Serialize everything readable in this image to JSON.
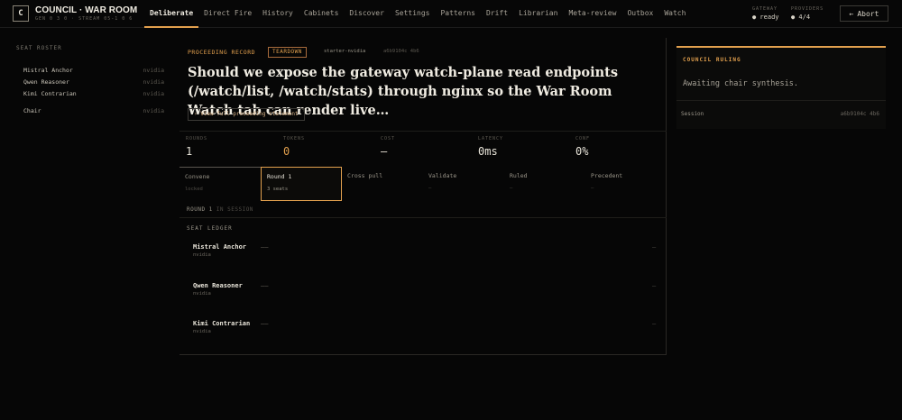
{
  "app": {
    "logo_letter": "C",
    "title": "COUNCIL · WAR ROOM",
    "subtitle": "GEN 0 3 0 · STREAM 05-1 0 6"
  },
  "nav": [
    {
      "label": "Deliberate",
      "active": true
    },
    {
      "label": "Direct Fire",
      "active": false
    },
    {
      "label": "History",
      "active": false
    },
    {
      "label": "Cabinets",
      "active": false
    },
    {
      "label": "Discover",
      "active": false
    },
    {
      "label": "Settings",
      "active": false
    },
    {
      "label": "Patterns",
      "active": false
    },
    {
      "label": "Drift",
      "active": false
    },
    {
      "label": "Librarian",
      "active": false
    },
    {
      "label": "Meta-review",
      "active": false
    },
    {
      "label": "Outbox",
      "active": false
    },
    {
      "label": "Watch",
      "active": false
    }
  ],
  "status": {
    "gateway_label": "GATEWAY",
    "gateway_value": "● ready",
    "providers_label": "PROVIDERS",
    "providers_value": "● 4/4"
  },
  "abort": {
    "icon": "←",
    "label": "Abort"
  },
  "sidebar": {
    "title": "SEAT ROSTER",
    "seats": [
      {
        "name": "Mistral Anchor",
        "provider": "nvidia"
      },
      {
        "name": "Qwen Reasoner",
        "provider": "nvidia"
      },
      {
        "name": "Kimi Contrarian",
        "provider": "nvidia"
      },
      {
        "name": "Chair",
        "provider": "nvidia"
      }
    ]
  },
  "record": {
    "label": "PROCEEDING RECORD",
    "badge": "TEARDOWN",
    "tag1": "starter-nvidia",
    "tag2": "a6b9104c 4b6",
    "question": "Should we expose the gateway watch-plane read endpoints (/watch/list, /watch/stats) through nginx so the War Room Watch tab can render live…",
    "view_button": "› View full proceeding statement"
  },
  "metrics": [
    {
      "label": "ROUNDS",
      "value": "1"
    },
    {
      "label": "TOKENS",
      "value": "0"
    },
    {
      "label": "COST",
      "value": "—"
    },
    {
      "label": "LATENCY",
      "value": "0ms"
    },
    {
      "label": "CONF",
      "value": "0%"
    }
  ],
  "stages": [
    {
      "label": "Convene",
      "sub": "locked"
    },
    {
      "label": "Round 1",
      "sub": "3 seats"
    },
    {
      "label": "Cross pull",
      "sub": ""
    },
    {
      "label": "Validate",
      "sub": "—"
    },
    {
      "label": "Ruled",
      "sub": "—"
    },
    {
      "label": "Precedent",
      "sub": "—"
    }
  ],
  "round": {
    "label": "ROUND 1",
    "status": "IN SESSION"
  },
  "ledger": {
    "title": "SEAT LEDGER",
    "rows": [
      {
        "name": "Mistral Anchor",
        "provider": "nvidia",
        "c1": "——",
        "c2": "—"
      },
      {
        "name": "Qwen Reasoner",
        "provider": "nvidia",
        "c1": "——",
        "c2": "—"
      },
      {
        "name": "Kimi Contrarian",
        "provider": "nvidia",
        "c1": "——",
        "c2": "—"
      }
    ]
  },
  "ruling": {
    "title": "COUNCIL RULING",
    "message": "Awaiting chair synthesis.",
    "session_key": "Session",
    "session_value": "a6b9104c 4b6"
  },
  "colors": {
    "accent": "#e2a04e",
    "background": "#060606"
  }
}
